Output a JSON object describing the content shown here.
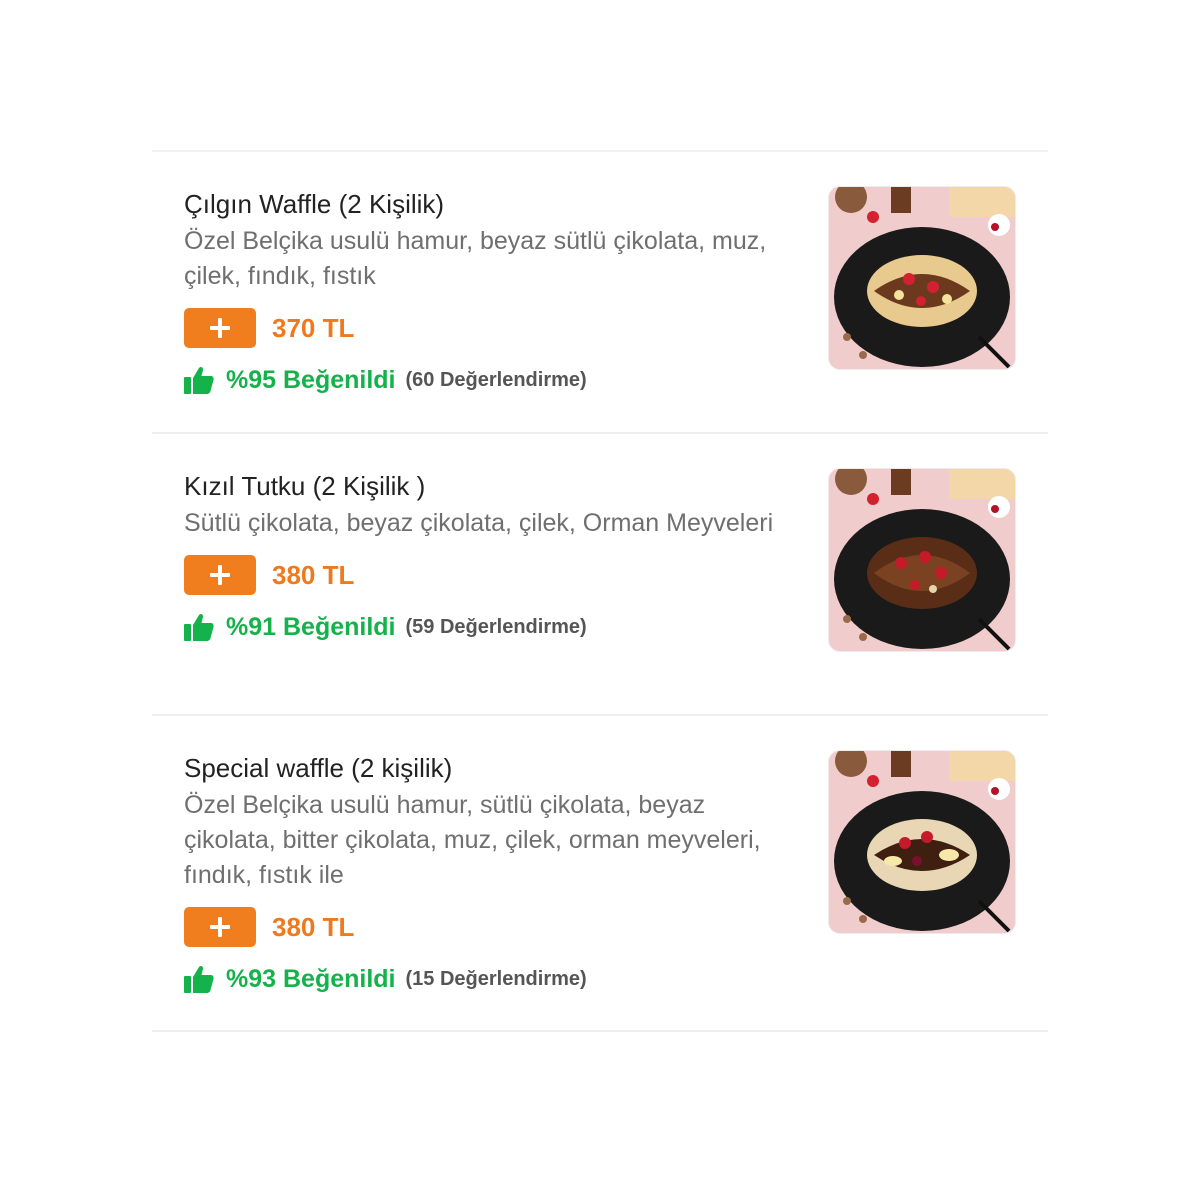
{
  "menu": {
    "items": [
      {
        "title": "Çılgın Waffle (2 Kişilik)",
        "description": "Özel Belçika usulü hamur, beyaz sütlü çikolata, muz, çilek, fındık, fıstık",
        "price": "370 TL",
        "rating": "%95 Beğenildi",
        "review_count": "(60 Değerlendirme)",
        "add_icon": "plus-icon",
        "rating_icon": "thumbs-up-icon"
      },
      {
        "title": "Kızıl Tutku (2 Kişilik )",
        "description": "Sütlü çikolata, beyaz çikolata, çilek, Orman Meyveleri",
        "price": "380 TL",
        "rating": "%91 Beğenildi",
        "review_count": "(59 Değerlendirme)",
        "add_icon": "plus-icon",
        "rating_icon": "thumbs-up-icon"
      },
      {
        "title": "Special waffle (2 kişilik)",
        "description": "Özel Belçika usulü hamur, sütlü çikolata, beyaz çikolata, bitter çikolata, muz, çilek, orman meyveleri, fındık, fıstık ile",
        "price": "380 TL",
        "rating": "%93 Beğenildi",
        "review_count": "(15 Değerlendirme)",
        "add_icon": "plus-icon",
        "rating_icon": "thumbs-up-icon"
      }
    ]
  },
  "colors": {
    "accent_orange": "#f07d1e",
    "rating_green": "#14b24a",
    "title_text": "#222222",
    "description_text": "#6f6f6f"
  }
}
